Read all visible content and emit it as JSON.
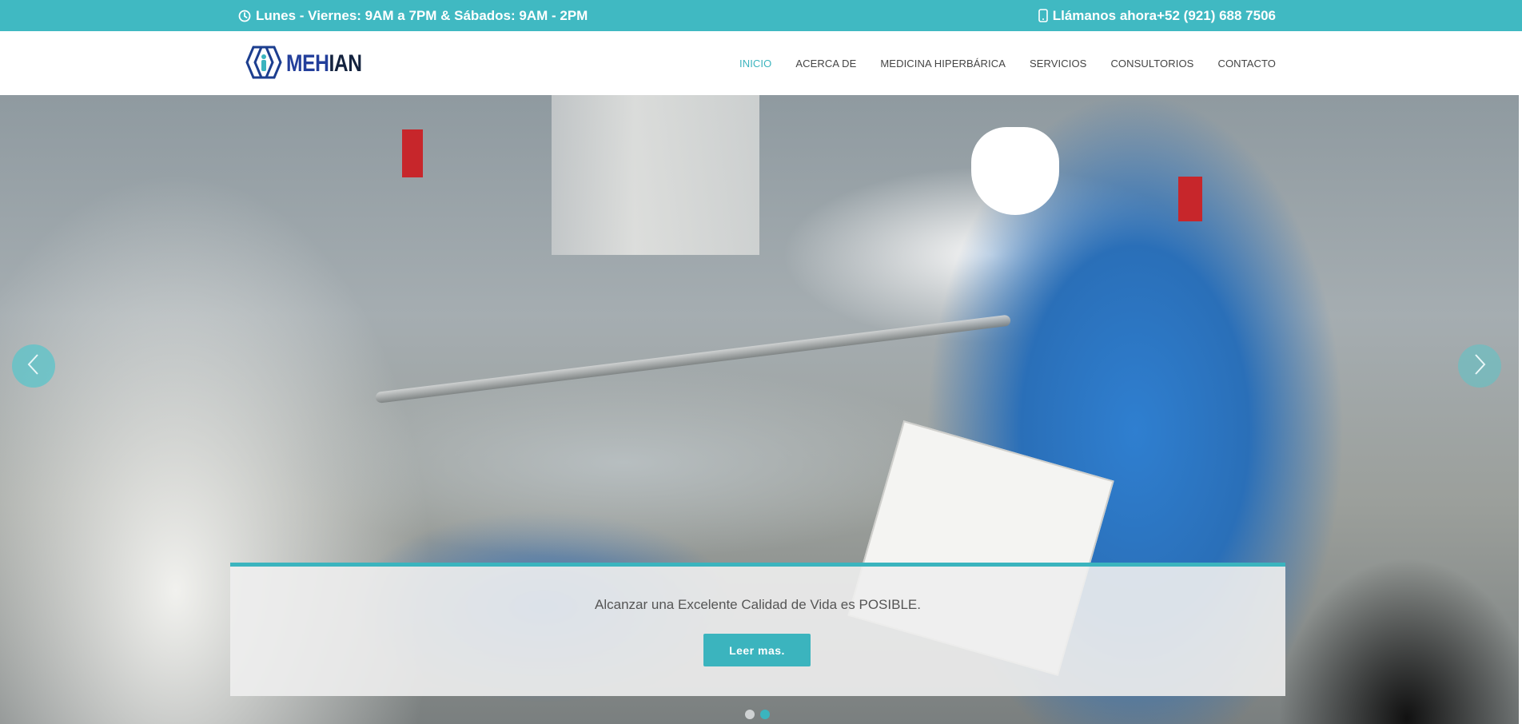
{
  "topbar": {
    "hours": "Lunes - Viernes: 9AM a 7PM & Sábados: 9AM - 2PM",
    "phone": "Llámanos ahora+52 (921) 688 7506",
    "hours_icon": "clock-icon",
    "phone_icon": "mobile-phone-icon",
    "color": "#40b9c2"
  },
  "brand": {
    "name_part1": "MEH",
    "name_part2": "IAN",
    "logo_icon": "hexagon-people-logo"
  },
  "nav": {
    "items": [
      {
        "label": "INICIO",
        "active": true
      },
      {
        "label": "ACERCA DE",
        "active": false
      },
      {
        "label": "MEDICINA HIPERBÁRICA",
        "active": false
      },
      {
        "label": "SERVICIOS",
        "active": false
      },
      {
        "label": "CONSULTORIOS",
        "active": false
      },
      {
        "label": "CONTACTO",
        "active": false
      }
    ],
    "active_color": "#3bb4be"
  },
  "slider": {
    "caption": "Alcanzar una Excelente Calidad de Vida es POSIBLE.",
    "button_label": "Leer mas.",
    "prev_icon": "chevron-left-icon",
    "next_icon": "chevron-right-icon",
    "slide_count": 2,
    "active_slide": 2
  }
}
